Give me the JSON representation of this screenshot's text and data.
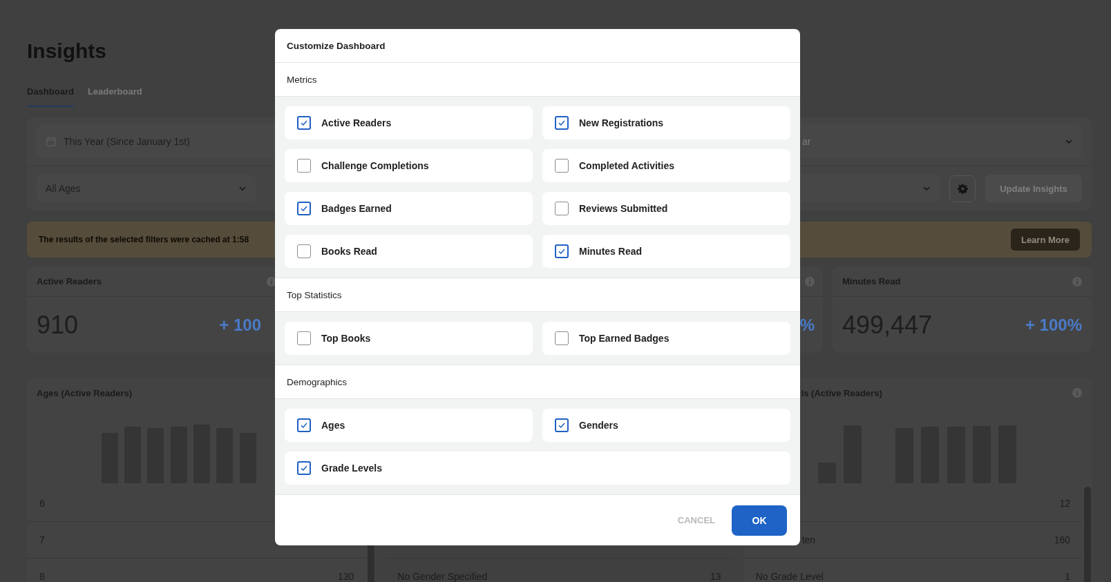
{
  "page": {
    "title": "Insights"
  },
  "tabs": [
    {
      "label": "Dashboard",
      "selected": true
    },
    {
      "label": "Leaderboard",
      "selected": false
    }
  ],
  "filters": {
    "date_range": "This Year (Since January 1st)",
    "field_2": "ar",
    "age": "All Ages",
    "update_button": {
      "label": "Update Insights",
      "disabled": true
    }
  },
  "banner": {
    "message": "The results of the selected filters were cached at 1:58",
    "button": "Learn More"
  },
  "metric_cards": [
    {
      "title": "Active Readers",
      "value": "910",
      "change": "+ 100"
    },
    {
      "change": "%"
    },
    {
      "title": "Minutes Read",
      "value": "499,447",
      "change": "+ 100%"
    }
  ],
  "chart_cards": [
    {
      "title": "Ages (Active Readers)",
      "rows": [
        {
          "label": "6"
        },
        {
          "label": "7"
        },
        {
          "label": "8",
          "value": "130"
        }
      ]
    },
    {
      "rows": [
        {
          "label": "No Gender Specified",
          "value": "13"
        }
      ]
    },
    {
      "title": "ls (Active Readers)",
      "rows": [
        {
          "value": "12"
        },
        {
          "label": "ten",
          "value": "160"
        },
        {
          "label": "No Grade Level",
          "value": "1"
        }
      ]
    }
  ],
  "dialog": {
    "title": "Customize Dashboard",
    "sections": [
      {
        "title": "Metrics",
        "items": [
          {
            "label": "Active Readers",
            "checked": true
          },
          {
            "label": "New Registrations",
            "checked": true
          },
          {
            "label": "Challenge Completions",
            "checked": false
          },
          {
            "label": "Completed Activities",
            "checked": false
          },
          {
            "label": "Badges Earned",
            "checked": true
          },
          {
            "label": "Reviews Submitted",
            "checked": false
          },
          {
            "label": "Books Read",
            "checked": false
          },
          {
            "label": "Minutes Read",
            "checked": true
          }
        ]
      },
      {
        "title": "Top Statistics",
        "items": [
          {
            "label": "Top Books",
            "checked": false
          },
          {
            "label": "Top Earned Badges",
            "checked": false
          }
        ]
      },
      {
        "title": "Demographics",
        "items": [
          {
            "label": "Ages",
            "checked": true
          },
          {
            "label": "Genders",
            "checked": true
          },
          {
            "label": "Grade Levels",
            "checked": true
          }
        ]
      }
    ],
    "buttons": [
      {
        "label": "CANCEL",
        "kind": "text"
      },
      {
        "label": "OK",
        "kind": "primary"
      }
    ]
  }
}
